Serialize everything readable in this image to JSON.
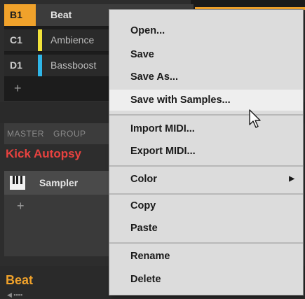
{
  "groups": [
    {
      "id": "B1",
      "name": "Beat",
      "color": "#f0a22b",
      "active": true
    },
    {
      "id": "C1",
      "name": "Ambience",
      "color": "#f2e33a",
      "active": false
    },
    {
      "id": "D1",
      "name": "Bassboost",
      "color": "#2fb6e8",
      "active": false
    }
  ],
  "group_add": "+",
  "tabs": {
    "master": "MASTER",
    "group": "GROUP"
  },
  "sound_title": "Kick Autopsy",
  "plugin": {
    "name": "Sampler",
    "icon": "piano-keys-icon",
    "add": "+"
  },
  "bottom": {
    "label": "Beat",
    "arrow": "◀ ▪▪▪▪"
  },
  "menu": {
    "open": "Open...",
    "save": "Save",
    "save_as": "Save As...",
    "save_with_samples": "Save with Samples...",
    "import_midi": "Import MIDI...",
    "export_midi": "Export MIDI...",
    "color": "Color",
    "submenu_arrow": "▶",
    "copy": "Copy",
    "paste": "Paste",
    "rename": "Rename",
    "delete": "Delete",
    "highlighted": "save_with_samples"
  },
  "colors": {
    "accent": "#f0a22b",
    "sound_title": "#e8423f"
  }
}
